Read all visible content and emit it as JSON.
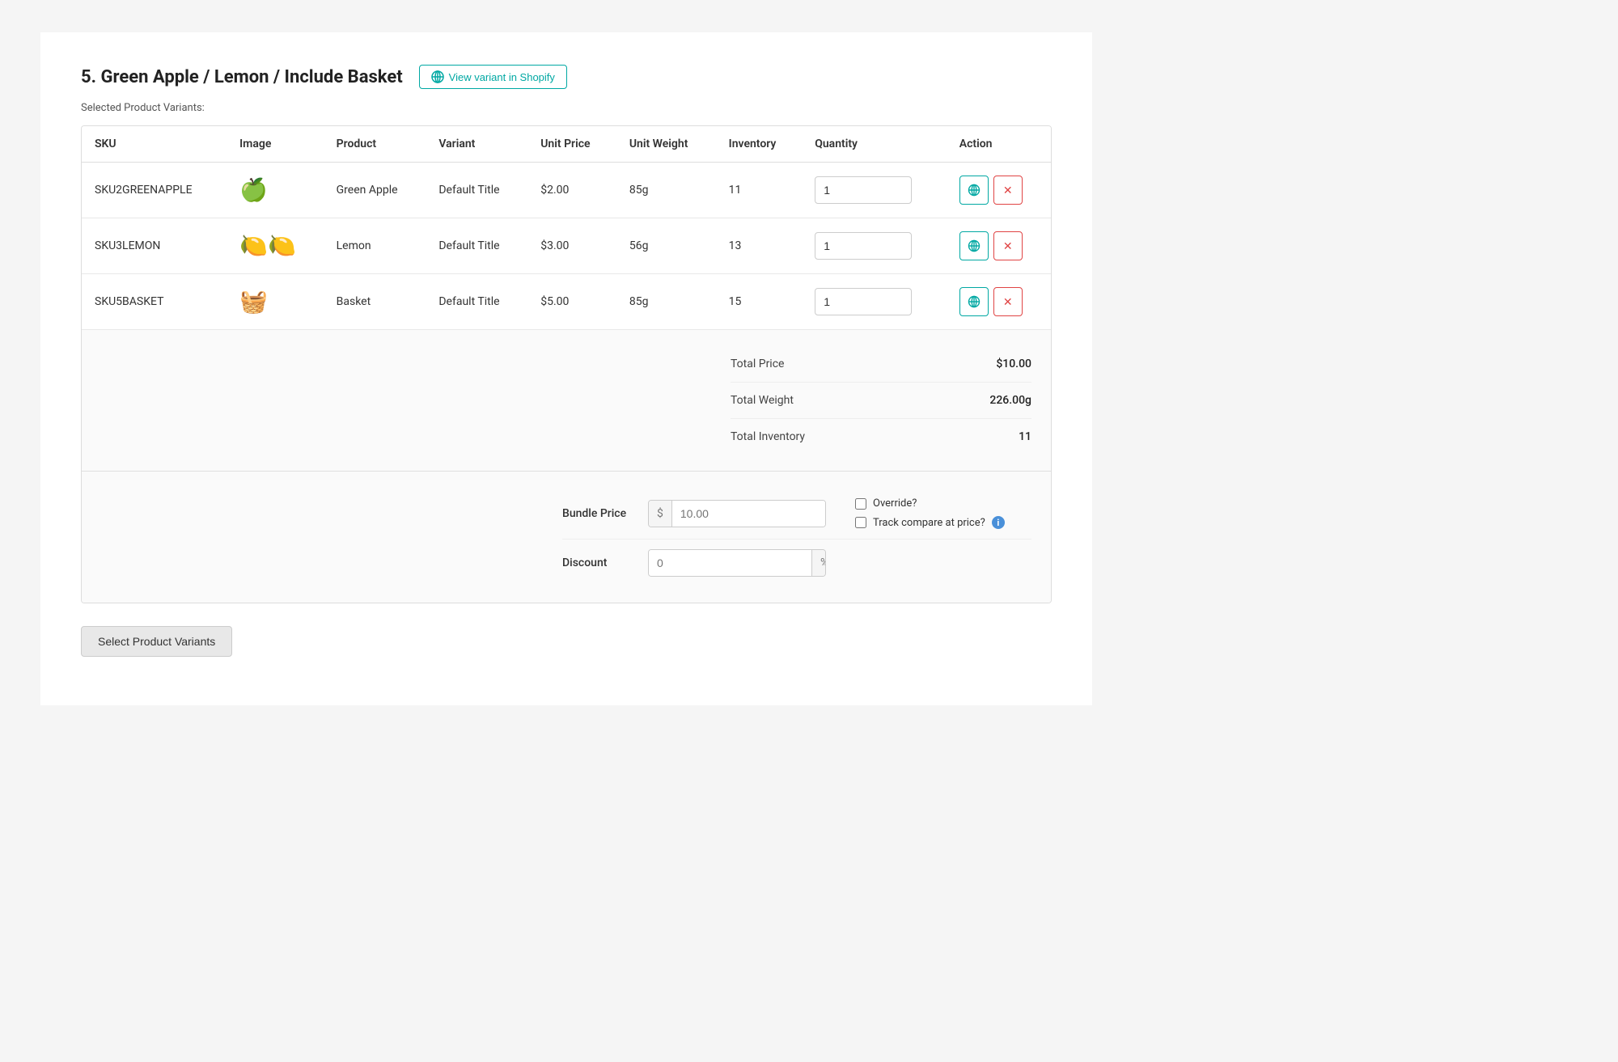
{
  "header": {
    "title": "5. Green Apple / Lemon / Include Basket",
    "shopify_btn_label": "View variant in Shopify"
  },
  "selected_label": "Selected Product Variants:",
  "table": {
    "columns": [
      "SKU",
      "Image",
      "Product",
      "Variant",
      "Unit Price",
      "Unit Weight",
      "Inventory",
      "Quantity",
      "Action"
    ],
    "rows": [
      {
        "sku": "SKU2GREENAPPLE",
        "image_emoji": "🍏",
        "product": "Green Apple",
        "variant": "Default Title",
        "unit_price": "$2.00",
        "unit_weight": "85g",
        "inventory": "11",
        "quantity": "1"
      },
      {
        "sku": "SKU3LEMON",
        "image_emoji": "🍋🍋",
        "product": "Lemon",
        "variant": "Default Title",
        "unit_price": "$3.00",
        "unit_weight": "56g",
        "inventory": "13",
        "quantity": "1"
      },
      {
        "sku": "SKU5BASKET",
        "image_emoji": "🧺",
        "product": "Basket",
        "variant": "Default Title",
        "unit_price": "$5.00",
        "unit_weight": "85g",
        "inventory": "15",
        "quantity": "1"
      }
    ]
  },
  "summary": {
    "total_price_label": "Total Price",
    "total_price_value": "$10.00",
    "total_weight_label": "Total Weight",
    "total_weight_value": "226.00g",
    "total_inventory_label": "Total Inventory",
    "total_inventory_value": "11"
  },
  "bundle": {
    "price_label": "Bundle Price",
    "price_placeholder": "10.00",
    "currency_symbol": "$",
    "discount_label": "Discount",
    "discount_placeholder": "0",
    "percent_symbol": "%",
    "override_label": "Override?",
    "track_label": "Track compare at price?",
    "info_tooltip": "i"
  },
  "footer": {
    "select_variants_btn": "Select Product Variants"
  },
  "colors": {
    "teal": "#00a8a3",
    "red": "#e04444",
    "blue_info": "#4a90d9"
  }
}
